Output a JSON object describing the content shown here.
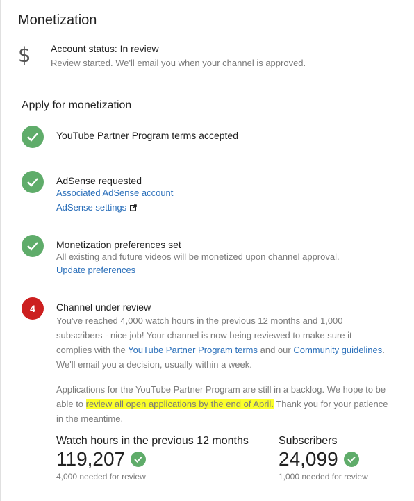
{
  "page": {
    "title": "Monetization"
  },
  "account": {
    "icon": "dollar-icon",
    "status": "Account status: In review",
    "subtitle": "Review started. We'll email you when your channel is approved."
  },
  "apply": {
    "title": "Apply for monetization",
    "steps": [
      {
        "state": "done",
        "title": "YouTube Partner Program terms accepted"
      },
      {
        "state": "done",
        "title": "AdSense requested",
        "links": [
          "Associated AdSense account",
          "AdSense settings"
        ]
      },
      {
        "state": "done",
        "title": "Monetization preferences set",
        "description": "All existing and future videos will be monetized upon channel approval.",
        "links": [
          "Update preferences"
        ]
      },
      {
        "state": "current",
        "number": "4",
        "title": "Channel under review",
        "para1": {
          "before": "You've reached 4,000 watch hours in the previous 12 months and 1,000 subscribers - nice job! Your channel is now being reviewed to make sure it complies with the ",
          "link1": "YouTube Partner Program terms",
          "middle": " and our ",
          "link2": "Community guidelines",
          "after": ". We'll email you a decision, usually within a week."
        },
        "para2": {
          "before": "Applications for the YouTube Partner Program are still in a backlog. We hope to be able to ",
          "highlight": "review all open applications by the end of April.",
          "after": " Thank you for your patience in the meantime."
        }
      }
    ]
  },
  "stats": {
    "watch_hours": {
      "label": "Watch hours in the previous 12 months",
      "value": "119,207",
      "note": "4,000 needed for review"
    },
    "subscribers": {
      "label": "Subscribers",
      "value": "24,099",
      "note": "1,000 needed for review"
    }
  },
  "colors": {
    "check": "#5fac6a",
    "current": "#cc1f1f",
    "link": "#2a6fba",
    "highlight": "#fbff2a"
  }
}
